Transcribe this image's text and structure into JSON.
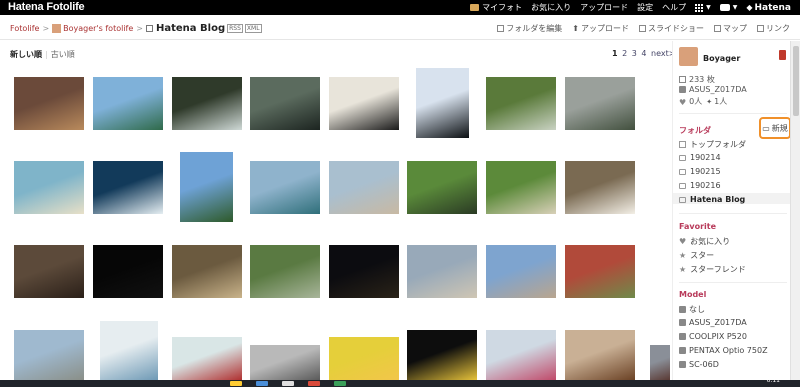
{
  "topbar": {
    "logo": "Hatena Fotolife",
    "nav": [
      {
        "label": "マイフォト",
        "icon": "folder-icon"
      },
      {
        "label": "お気に入り"
      },
      {
        "label": "アップロード"
      },
      {
        "label": "設定"
      },
      {
        "label": "ヘルプ"
      }
    ],
    "apps_icon": "grid-icon",
    "notify_icon": "speech-bubble-icon",
    "brand": "Hatena"
  },
  "breadcrumb": {
    "root": "Fotolife",
    "user": "Boyager's fotolife",
    "current": "Hatena Blog",
    "badges": [
      "RSS",
      "XML"
    ]
  },
  "actions": [
    {
      "label": "フォルダを編集",
      "icon": "edit-folder-icon"
    },
    {
      "label": "アップロード",
      "icon": "upload-icon"
    },
    {
      "label": "スライドショー",
      "icon": "slideshow-icon"
    },
    {
      "label": "マップ",
      "icon": "map-icon"
    },
    {
      "label": "リンク",
      "icon": "link-icon"
    }
  ],
  "sort": {
    "newest": "新しい順",
    "oldest": "古い順"
  },
  "pager": {
    "current": "1",
    "pages": [
      "2",
      "3",
      "4"
    ],
    "next": "next>"
  },
  "photos": [
    {
      "colors": [
        "#6b4a3a",
        "#b98a5c"
      ]
    },
    {
      "colors": [
        "#7fb1d9",
        "#2f6a4a"
      ]
    },
    {
      "colors": [
        "#2f3a2a",
        "#cfd9d6"
      ]
    },
    {
      "colors": [
        "#5b6b5e",
        "#1c2420"
      ]
    },
    {
      "colors": [
        "#e8e4da",
        "#1a1a1a"
      ]
    },
    {
      "colors": [
        "#d8e2ee",
        "#0b0f12"
      ]
    },
    {
      "colors": [
        "#5a7a3a",
        "#c9d2c2"
      ]
    },
    {
      "colors": [
        "#9aa09b",
        "#42503e"
      ]
    },
    {
      "colors": [
        "#7fb4c9",
        "#e8e0c8"
      ]
    },
    {
      "colors": [
        "#123a5a",
        "#e5eef2"
      ]
    },
    {
      "colors": [
        "#6ea2d6",
        "#2e5a2a"
      ]
    },
    {
      "colors": [
        "#8fb3cc",
        "#2f6f7a"
      ]
    },
    {
      "colors": [
        "#a9bfcf",
        "#c8b9a3"
      ]
    },
    {
      "colors": [
        "#5a8a3a",
        "#2a3a24"
      ]
    },
    {
      "colors": [
        "#5c8a3a",
        "#d8d0b8"
      ]
    },
    {
      "colors": [
        "#7a6a52",
        "#f3efe6"
      ]
    },
    {
      "colors": [
        "#5c4a3a",
        "#2a1f18"
      ]
    },
    {
      "colors": [
        "#060606",
        "#111111"
      ]
    },
    {
      "colors": [
        "#6b5a3f",
        "#c9b38a"
      ]
    },
    {
      "colors": [
        "#5a7a42",
        "#a8b59a"
      ]
    },
    {
      "colors": [
        "#0c0c10",
        "#2a2318"
      ]
    },
    {
      "colors": [
        "#98a9b9",
        "#cfc6b4"
      ]
    },
    {
      "colors": [
        "#7ea4cf",
        "#b9a58e"
      ]
    },
    {
      "colors": [
        "#b14a3a",
        "#6f8a4a"
      ]
    },
    {
      "colors": [
        "#9fb9cf",
        "#8a8f88"
      ]
    },
    {
      "colors": [
        "#e6edf0",
        "#6e99b5"
      ]
    },
    {
      "colors": [
        "#d9e6e6",
        "#b03030"
      ]
    },
    {
      "colors": [
        "#b9b9b9",
        "#5a5a5a"
      ]
    },
    {
      "colors": [
        "#e5cf3a",
        "#f2c64a"
      ]
    },
    {
      "colors": [
        "#0d0d0d",
        "#e6c23a"
      ]
    },
    {
      "colors": [
        "#cfd9e3",
        "#c04a6a"
      ]
    },
    {
      "colors": [
        "#c9b095",
        "#6b4225"
      ]
    },
    {
      "colors": [
        "#8a8f98",
        "#5a3a34"
      ]
    }
  ],
  "sidebar": {
    "username": "Boyager",
    "photo_count": "233 枚",
    "camera": "ASUS_Z017DA",
    "likes": "0人",
    "stars": "1人",
    "folder_heading": "フォルダ",
    "new_button": "新規",
    "folders": [
      {
        "label": "トップフォルダ",
        "icon": "checkbox"
      },
      {
        "label": "190214",
        "icon": "folder"
      },
      {
        "label": "190215",
        "icon": "folder"
      },
      {
        "label": "190216",
        "icon": "folder"
      },
      {
        "label": "Hatena Blog",
        "icon": "folder",
        "selected": true
      }
    ],
    "favorite_heading": "Favorite",
    "favorites": [
      {
        "label": "お気に入り",
        "icon": "heart-icon"
      },
      {
        "label": "スター",
        "icon": "star-icon"
      },
      {
        "label": "スターフレンド",
        "icon": "star-icon"
      }
    ],
    "model_heading": "Model",
    "models": [
      "なし",
      "ASUS_Z017DA",
      "COOLPIX P520",
      "PENTAX Optio 750Z",
      "SC-06D"
    ]
  },
  "taskbar": {
    "clock": "6:11"
  }
}
